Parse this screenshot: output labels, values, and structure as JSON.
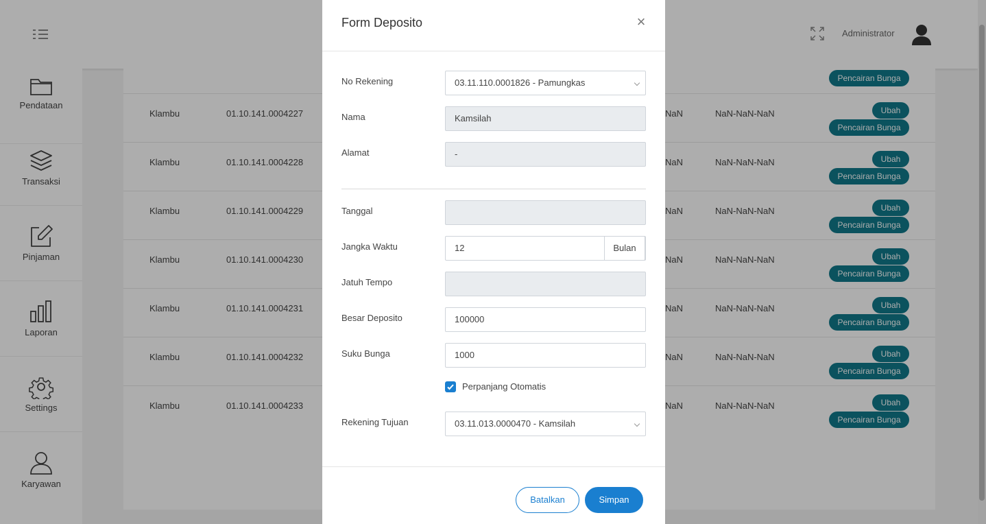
{
  "header": {
    "user_name": "Administrator"
  },
  "sidebar": {
    "items": [
      {
        "label": "Pendataan",
        "icon": "folder-icon"
      },
      {
        "label": "Transaksi",
        "icon": "layers-icon"
      },
      {
        "label": "Pinjaman",
        "icon": "edit-icon"
      },
      {
        "label": "Laporan",
        "icon": "bar-chart-icon"
      },
      {
        "label": "Settings",
        "icon": "gear-icon"
      },
      {
        "label": "Karyawan",
        "icon": "user-icon"
      }
    ]
  },
  "table": {
    "top_row_action": "Pencairan Bunga",
    "rows": [
      {
        "branch": "Klambu",
        "account": "01.10.141.0004227",
        "col3": "NaN",
        "date": "NaN-NaN-NaN",
        "edit": "Ubah",
        "withdraw": "Pencairan Bunga"
      },
      {
        "branch": "Klambu",
        "account": "01.10.141.0004228",
        "col3": "NaN",
        "date": "NaN-NaN-NaN",
        "edit": "Ubah",
        "withdraw": "Pencairan Bunga"
      },
      {
        "branch": "Klambu",
        "account": "01.10.141.0004229",
        "col3": "NaN",
        "date": "NaN-NaN-NaN",
        "edit": "Ubah",
        "withdraw": "Pencairan Bunga"
      },
      {
        "branch": "Klambu",
        "account": "01.10.141.0004230",
        "col3": "NaN",
        "date": "NaN-NaN-NaN",
        "edit": "Ubah",
        "withdraw": "Pencairan Bunga"
      },
      {
        "branch": "Klambu",
        "account": "01.10.141.0004231",
        "col3": "NaN",
        "date": "NaN-NaN-NaN",
        "edit": "Ubah",
        "withdraw": "Pencairan Bunga"
      },
      {
        "branch": "Klambu",
        "account": "01.10.141.0004232",
        "col3": "NaN",
        "date": "NaN-NaN-NaN",
        "edit": "Ubah",
        "withdraw": "Pencairan Bunga"
      },
      {
        "branch": "Klambu",
        "account": "01.10.141.0004233",
        "col3": "NaN",
        "date": "NaN-NaN-NaN",
        "edit": "Ubah",
        "withdraw": "Pencairan Bunga"
      }
    ]
  },
  "modal": {
    "title": "Form Deposito",
    "close": "×",
    "fields": {
      "no_rekening": {
        "label": "No Rekening",
        "value": "03.11.110.0001826 - Pamungkas"
      },
      "nama": {
        "label": "Nama",
        "value": "Kamsilah"
      },
      "alamat": {
        "label": "Alamat",
        "value": "-"
      },
      "tanggal": {
        "label": "Tanggal",
        "value": ""
      },
      "jangka_waktu": {
        "label": "Jangka Waktu",
        "value": "12",
        "unit": "Bulan"
      },
      "jatuh_tempo": {
        "label": "Jatuh Tempo",
        "value": ""
      },
      "besar_deposito": {
        "label": "Besar Deposito",
        "value": "100000"
      },
      "suku_bunga": {
        "label": "Suku Bunga",
        "value": "1000"
      },
      "perpanjang": {
        "label": "Perpanjang Otomatis",
        "checked": true
      },
      "rekening_tujuan": {
        "label": "Rekening Tujuan",
        "value": "03.11.013.0000470 - Kamsilah"
      }
    },
    "buttons": {
      "cancel": "Batalkan",
      "save": "Simpan"
    }
  },
  "colors": {
    "primary": "#1a7fd0",
    "teal": "#117a8b"
  }
}
